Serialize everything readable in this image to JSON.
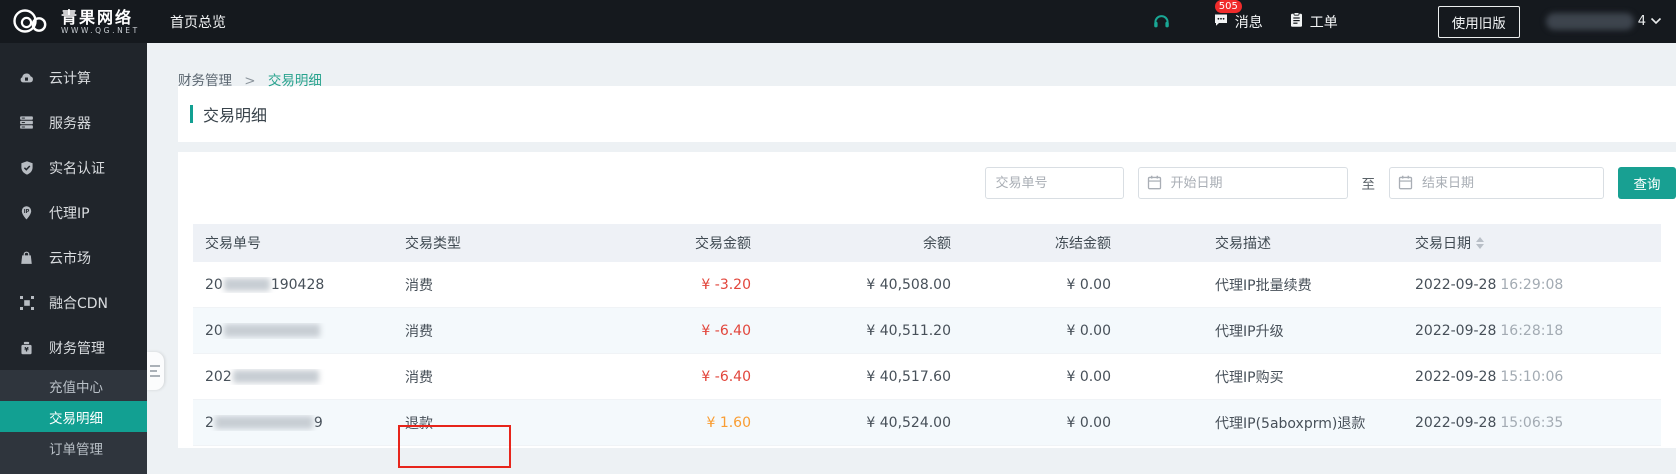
{
  "brand": {
    "name": "青果网络",
    "url": "WWW.QG.NET"
  },
  "topnav": {
    "home": "首页总览",
    "messages": {
      "label": "消息",
      "badge": "505"
    },
    "tickets": {
      "label": "工单"
    },
    "legacy_button": "使用旧版",
    "user": {
      "visible_suffix": "4"
    }
  },
  "sidebar": {
    "items": [
      {
        "label": "云计算"
      },
      {
        "label": "服务器"
      },
      {
        "label": "实名认证"
      },
      {
        "label": "代理IP"
      },
      {
        "label": "云市场"
      },
      {
        "label": "融合CDN"
      },
      {
        "label": "财务管理"
      }
    ],
    "submenu": [
      {
        "label": "充值中心"
      },
      {
        "label": "交易明细"
      },
      {
        "label": "订单管理"
      }
    ],
    "active_submenu": "交易明细"
  },
  "breadcrumb": {
    "parent": "财务管理",
    "separator": ">",
    "current": "交易明细"
  },
  "page": {
    "title": "交易明细"
  },
  "filters": {
    "order_no_placeholder": "交易单号",
    "start_date_placeholder": "开始日期",
    "range_separator": "至",
    "end_date_placeholder": "结束日期",
    "search_button": "查询"
  },
  "table": {
    "headers": [
      "交易单号",
      "交易类型",
      "交易金额",
      "余额",
      "冻结金额",
      "交易描述",
      "交易日期"
    ],
    "sorted_column": "交易日期",
    "rows": [
      {
        "order_prefix": "20",
        "order_suffix": "190428",
        "type": "消费",
        "amount": "¥ -3.20",
        "amount_sign": "negative",
        "balance": "¥ 40,508.00",
        "frozen": "¥ 0.00",
        "description": "代理IP批量续费",
        "date": "2022-09-28",
        "time": "16:29:08"
      },
      {
        "order_prefix": "20",
        "order_suffix": "",
        "type": "消费",
        "amount": "¥ -6.40",
        "amount_sign": "negative",
        "balance": "¥ 40,511.20",
        "frozen": "¥ 0.00",
        "description": "代理IP升级",
        "date": "2022-09-28",
        "time": "16:28:18"
      },
      {
        "order_prefix": "202",
        "order_suffix": "",
        "type": "消费",
        "amount": "¥ -6.40",
        "amount_sign": "negative",
        "balance": "¥ 40,517.60",
        "frozen": "¥ 0.00",
        "description": "代理IP购买",
        "date": "2022-09-28",
        "time": "15:10:06"
      },
      {
        "order_prefix": "2",
        "order_suffix": "9",
        "type": "退款",
        "amount": "¥ 1.60",
        "amount_sign": "positive",
        "balance": "¥ 40,524.00",
        "frozen": "¥ 0.00",
        "description": "代理IP(5aboxprm)退款",
        "date": "2022-09-28",
        "time": "15:06:35"
      }
    ]
  },
  "annotation": {
    "type": "red-box",
    "target": "refund-type-cell"
  },
  "colors": {
    "accent_teal": "#12A092",
    "negative_red": "#E2463C",
    "positive_orange": "#F99D33",
    "badge_red": "#F02B2B",
    "annotation_red": "#E7251B"
  }
}
